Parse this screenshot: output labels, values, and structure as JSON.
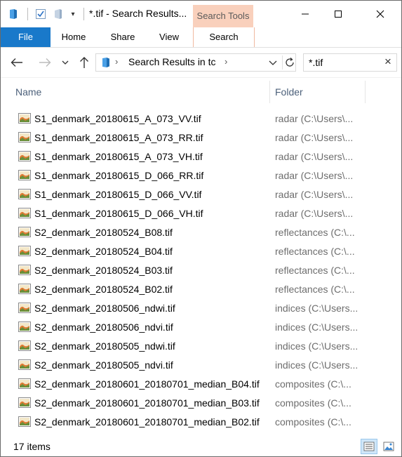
{
  "window": {
    "title": "*.tif - Search Results...",
    "context_tab_group": "Search Tools",
    "quick_access": {
      "folder_icon": "folder-icon",
      "properties_icon": "properties-icon",
      "new_folder_icon": "new-folder-icon",
      "customize_arrow": "▾"
    },
    "controls": {
      "minimize": "minimize-icon",
      "maximize": "maximize-icon",
      "close": "close-icon"
    }
  },
  "ribbon": {
    "tabs": [
      {
        "label": "File"
      },
      {
        "label": "Home"
      },
      {
        "label": "Share"
      },
      {
        "label": "View"
      },
      {
        "label": "Search"
      }
    ],
    "file_color": "#1979ca",
    "search_tools_color": "#f9d0bc"
  },
  "navigation": {
    "address_breadcrumb": "Search Results in tc",
    "search_box_value": "*.tif"
  },
  "columns": {
    "name": "Name",
    "folder": "Folder"
  },
  "files": [
    {
      "name": "S1_denmark_20180615_A_073_VV.tif",
      "folder": "radar (C:\\Users\\..."
    },
    {
      "name": "S1_denmark_20180615_A_073_RR.tif",
      "folder": "radar (C:\\Users\\..."
    },
    {
      "name": "S1_denmark_20180615_A_073_VH.tif",
      "folder": "radar (C:\\Users\\..."
    },
    {
      "name": "S1_denmark_20180615_D_066_RR.tif",
      "folder": "radar (C:\\Users\\..."
    },
    {
      "name": "S1_denmark_20180615_D_066_VV.tif",
      "folder": "radar (C:\\Users\\..."
    },
    {
      "name": "S1_denmark_20180615_D_066_VH.tif",
      "folder": "radar (C:\\Users\\..."
    },
    {
      "name": "S2_denmark_20180524_B08.tif",
      "folder": "reflectances (C:\\..."
    },
    {
      "name": "S2_denmark_20180524_B04.tif",
      "folder": "reflectances (C:\\..."
    },
    {
      "name": "S2_denmark_20180524_B03.tif",
      "folder": "reflectances (C:\\..."
    },
    {
      "name": "S2_denmark_20180524_B02.tif",
      "folder": "reflectances (C:\\..."
    },
    {
      "name": "S2_denmark_20180506_ndwi.tif",
      "folder": "indices (C:\\Users..."
    },
    {
      "name": "S2_denmark_20180506_ndvi.tif",
      "folder": "indices (C:\\Users..."
    },
    {
      "name": "S2_denmark_20180505_ndwi.tif",
      "folder": "indices (C:\\Users..."
    },
    {
      "name": "S2_denmark_20180505_ndvi.tif",
      "folder": "indices (C:\\Users..."
    },
    {
      "name": "S2_denmark_20180601_20180701_median_B04.tif",
      "folder": "composites (C:\\..."
    },
    {
      "name": "S2_denmark_20180601_20180701_median_B03.tif",
      "folder": "composites (C:\\..."
    },
    {
      "name": "S2_denmark_20180601_20180701_median_B02.tif",
      "folder": "composites (C:\\..."
    }
  ],
  "file_icon": "image-file-icon",
  "status": {
    "item_count": "17 items",
    "details_view_icon": "details-view-icon",
    "large_icons_view_icon": "large-icons-view-icon"
  }
}
